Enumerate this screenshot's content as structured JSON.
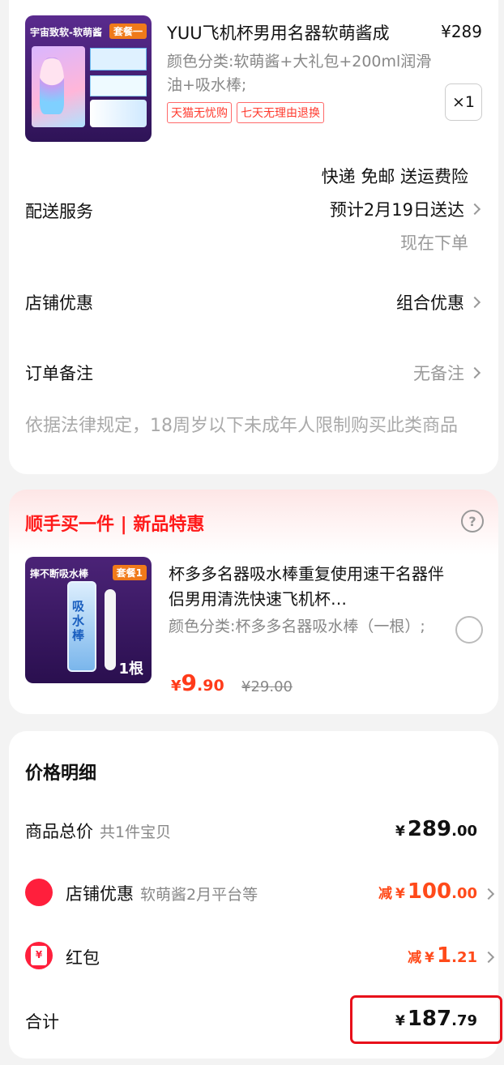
{
  "product1": {
    "thumb_banner_left": "宇宙致软-软萌酱",
    "thumb_banner_right": "套餐一",
    "title": "YUU飞机杯男用名器软萌酱成",
    "price": "¥289",
    "spec": "颜色分类:软萌酱+大礼包+200ml润滑油+吸水棒;",
    "tags": [
      "天猫无忧购",
      "七天无理由退换"
    ],
    "qty": "×1"
  },
  "delivery": {
    "label": "配送服务",
    "line1": "快递 免邮 送运费险",
    "line2": "预计2月19日送达",
    "line3": "现在下单"
  },
  "store_discount": {
    "label": "店铺优惠",
    "value": "组合优惠"
  },
  "order_note": {
    "label": "订单备注",
    "value": "无备注"
  },
  "notice": "依据法律规定，18周岁以下未成年人限制购买此类商品",
  "upsell": {
    "title": "顺手买一件 | 新品特惠",
    "thumb_banner_left": "摔不断吸水棒",
    "thumb_banner_right": "套餐1",
    "thumb_tube_text": "吸水棒",
    "thumb_count": "1根",
    "title_text": "杯多多名器吸水棒重复使用速干名器伴侣男用清洗快速飞机杯…",
    "spec": "颜色分类:杯多多名器吸水棒（一根）;",
    "price_symbol": "¥",
    "price_int": "9",
    "price_dec": ".90",
    "orig_price": "¥29.00"
  },
  "price_detail": {
    "title": "价格明细",
    "goods_label": "商品总价",
    "goods_sub": "共1件宝贝",
    "goods_symbol": "¥",
    "goods_int": "289",
    "goods_dec": ".00",
    "shop_label": "店铺优惠",
    "shop_sub": "软萌酱2月平台等",
    "shop_prefix": "减",
    "shop_symbol": "¥",
    "shop_int": "100",
    "shop_dec": ".00",
    "redpack_label": "红包",
    "redpack_prefix": "减",
    "redpack_symbol": "¥",
    "redpack_int": "1",
    "redpack_dec": ".21",
    "total_label": "合计",
    "total_symbol": "¥",
    "total_int": "187",
    "total_dec": ".79"
  },
  "colors": {
    "accent_red": "#ff3b1a",
    "highlight_border": "#e8101a",
    "icon_red": "#ff1f3c"
  },
  "icons": [
    "help-icon",
    "chevron-right-icon",
    "shop-coupon-icon",
    "red-envelope-icon"
  ]
}
